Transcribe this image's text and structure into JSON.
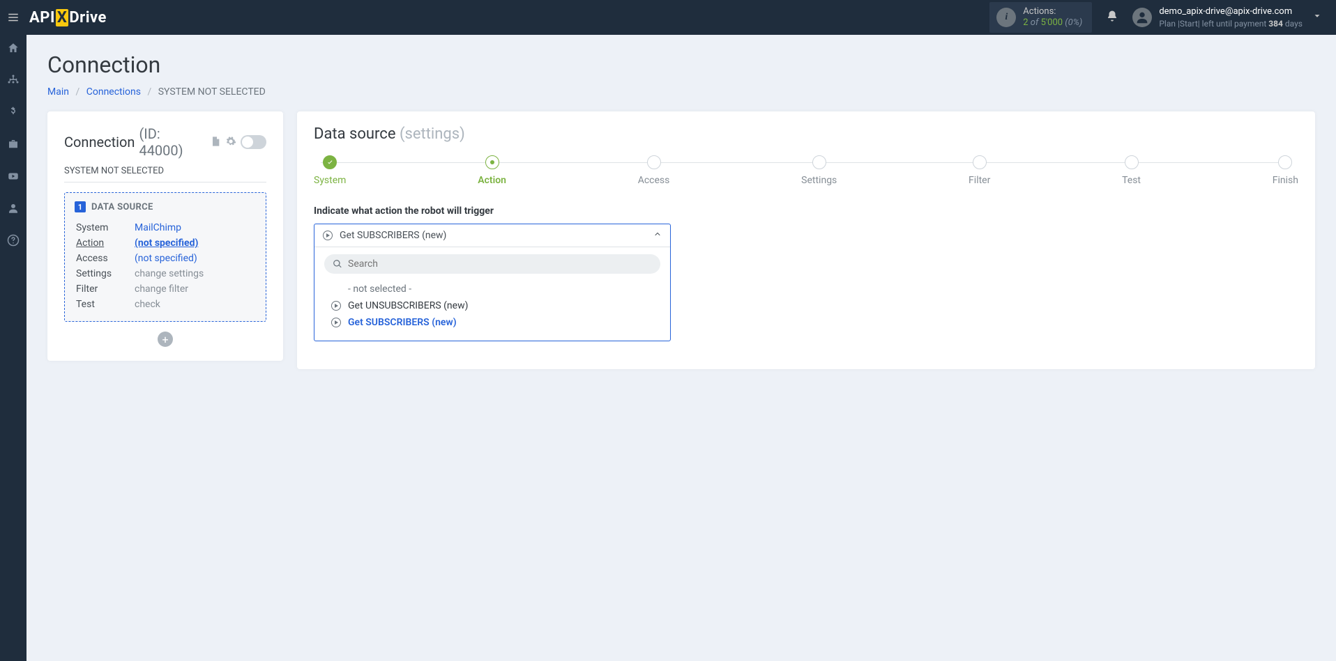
{
  "header": {
    "logo_part1": "API",
    "logo_x": "X",
    "logo_part2": "Drive",
    "actions_label": "Actions:",
    "actions_count": "2",
    "actions_of": " of ",
    "actions_total": "5'000",
    "actions_pct": "(0%)",
    "user_email": "demo_apix-drive@apix-drive.com",
    "plan_prefix": "Plan ",
    "plan_name": "|Start|",
    "plan_mid": " left until payment ",
    "plan_days_num": "384",
    "plan_days_word": " days"
  },
  "breadcrumbs": {
    "home": "Main",
    "connections": "Connections",
    "current": "SYSTEM NOT SELECTED"
  },
  "page": {
    "title": "Connection"
  },
  "left": {
    "title": "Connection",
    "id_label": "(ID: 44000)",
    "subhead": "SYSTEM NOT SELECTED",
    "badge": "1",
    "ds_title": "DATA SOURCE",
    "rows": {
      "system": {
        "label": "System",
        "value": "MailChimp"
      },
      "action": {
        "label": "Action",
        "value": "(not specified)"
      },
      "access": {
        "label": "Access",
        "value": "(not specified)"
      },
      "settings": {
        "label": "Settings",
        "value": "change settings"
      },
      "filter": {
        "label": "Filter",
        "value": "change filter"
      },
      "test": {
        "label": "Test",
        "value": "check"
      }
    }
  },
  "right": {
    "title_main": "Data source",
    "title_sub": "(settings)",
    "steps": {
      "s1": "System",
      "s2": "Action",
      "s3": "Access",
      "s4": "Settings",
      "s5": "Filter",
      "s6": "Test",
      "s7": "Finish"
    },
    "field_label": "Indicate what action the robot will trigger",
    "selected": "Get SUBSCRIBERS (new)",
    "search_placeholder": "Search",
    "opt_none": "- not selected -",
    "opt1": "Get UNSUBSCRIBERS (new)",
    "opt2": "Get SUBSCRIBERS (new)"
  }
}
